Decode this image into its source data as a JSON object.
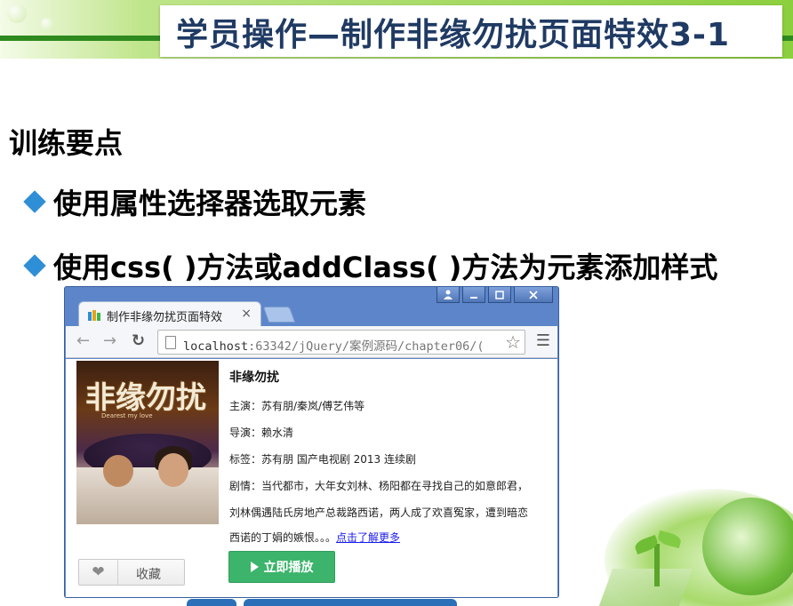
{
  "slide": {
    "title": "学员操作—制作非缘勿扰页面特效3-1",
    "section": "训练要点",
    "bullets": [
      "使用属性选择器选取元素",
      "使用css( )方法或addClass( )方法为元素添加样式"
    ]
  },
  "browser": {
    "tab_title": "制作非缘勿扰页面特效",
    "tab_close": "×",
    "url_host": "localhost",
    "url_rest": ":63342/jQuery/案例源码/chapter06/(",
    "window_controls": [
      "user",
      "minimize",
      "maximize",
      "close"
    ]
  },
  "movie": {
    "poster_title": "非缘勿扰",
    "poster_subtitle": "Dearest my love",
    "title": "非缘勿扰",
    "cast": "主演：苏有朋/秦岚/傅艺伟等",
    "director": "导演：赖水清",
    "tags": "标签：苏有朋 国产电视剧 2013 连续剧",
    "plot_line1": "剧情：当代都市，大年女刘林、杨阳都在寻找自己的如意郎君，",
    "plot_line2": "刘林偶遇陆氏房地产总裁路西诺，两人成了欢喜冤家，遭到暗恋",
    "plot_line3": "西诺的丁娟的嫉恨。。。",
    "more_link": "点击了解更多",
    "favorite_label": "收藏",
    "play_label": "立即播放"
  }
}
